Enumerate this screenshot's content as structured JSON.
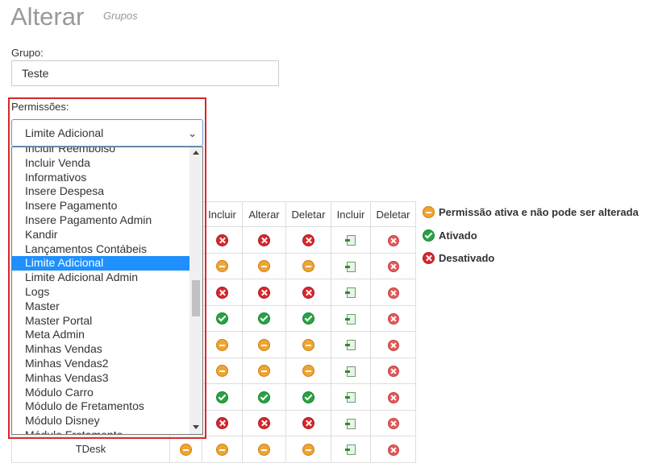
{
  "header": {
    "title": "Alterar",
    "subtitle": "Grupos"
  },
  "form": {
    "grupo_label": "Grupo:",
    "grupo_value": "Teste",
    "permissoes_label": "Permissões:",
    "select_value": "Limite Adicional",
    "options": [
      "Incluir Reembolso",
      "Incluir Venda",
      "Informativos",
      "Insere Despesa",
      "Insere Pagamento",
      "Insere Pagamento Admin",
      "Kandir",
      "Lançamentos Contábeis",
      "Limite Adicional",
      "Limite Adicional Admin",
      "Logs",
      "Master",
      "Master Portal",
      "Meta Admin",
      "Minhas Vendas",
      "Minhas Vendas2",
      "Minhas Vendas3",
      "Módulo Carro",
      "Módulo de Fretamentos",
      "Módulo Disney",
      "Módulo Fretamento"
    ],
    "selected_index": 8
  },
  "table": {
    "headers": [
      "Incluir",
      "Alterar",
      "Deletar",
      "Incluir",
      "Deletar"
    ],
    "rows": [
      {
        "name": "",
        "x": "",
        "cells": [
          "red",
          "red",
          "red",
          "doc",
          "smred"
        ]
      },
      {
        "name": "",
        "x": "",
        "cells": [
          "amber",
          "amber",
          "amber",
          "doc",
          "smred"
        ]
      },
      {
        "name": "",
        "x": "",
        "cells": [
          "red",
          "red",
          "red",
          "doc",
          "smred"
        ]
      },
      {
        "name": "",
        "x": "",
        "cells": [
          "green",
          "green",
          "green",
          "doc",
          "smred"
        ]
      },
      {
        "name": "",
        "x": "",
        "cells": [
          "amber",
          "amber",
          "amber",
          "doc",
          "smred"
        ]
      },
      {
        "name": "",
        "x": "",
        "cells": [
          "amber",
          "amber",
          "amber",
          "doc",
          "smred"
        ]
      },
      {
        "name": "",
        "x": "",
        "cells": [
          "green",
          "green",
          "green",
          "doc",
          "smred"
        ]
      },
      {
        "name": "",
        "x": "",
        "cells": [
          "red",
          "red",
          "red",
          "doc",
          "smred"
        ]
      },
      {
        "name": "TDesk",
        "x": "amber",
        "cells": [
          "amber",
          "amber",
          "amber",
          "doc",
          "smred"
        ]
      }
    ]
  },
  "legend": {
    "active_locked": "Permissão ativa e não pode ser alterada",
    "enabled": "Ativado",
    "disabled": "Desativado"
  },
  "colors": {
    "green": "#27a344",
    "red": "#d9262b",
    "amber": "#f0a530",
    "select_highlight": "#1e90ff",
    "annotation": "#d9262b"
  },
  "icons": {
    "green": "check-circle-icon",
    "red": "x-circle-icon",
    "amber": "minus-circle-icon",
    "doc": "document-arrow-icon",
    "smred": "small-x-circle-icon"
  }
}
